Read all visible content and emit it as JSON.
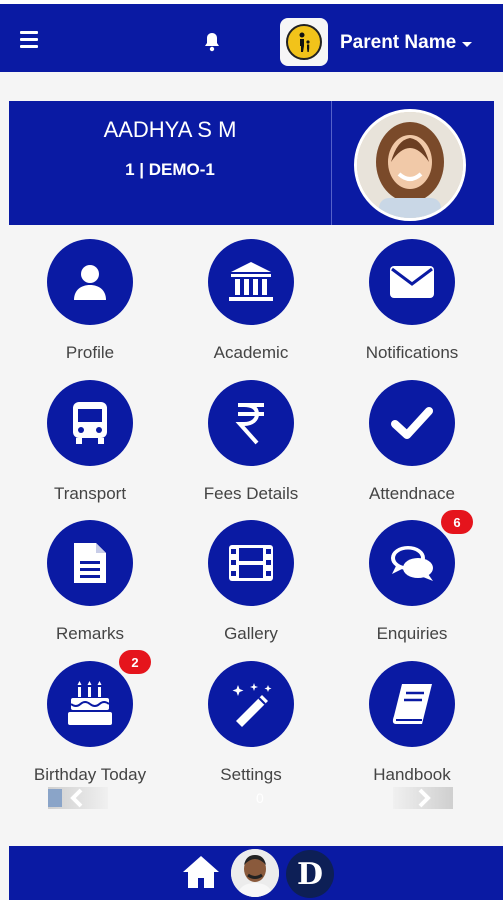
{
  "header": {
    "menu_icon": "hamburger-icon",
    "notification_icon": "bell-icon",
    "parent_logo": "parent-child-logo",
    "parent_name": "Parent Name"
  },
  "student": {
    "name": "AADHYA S M",
    "class_section": "1 | DEMO-1"
  },
  "menu": [
    {
      "label": "Profile",
      "icon": "user-icon"
    },
    {
      "label": "Academic",
      "icon": "bank-icon"
    },
    {
      "label": "Notifications",
      "icon": "envelope-icon"
    },
    {
      "label": "Transport",
      "icon": "bus-icon"
    },
    {
      "label": "Fees Details",
      "icon": "rupee-icon"
    },
    {
      "label": "Attendnace",
      "icon": "check-icon"
    },
    {
      "label": "Remarks",
      "icon": "document-icon"
    },
    {
      "label": "Gallery",
      "icon": "film-icon"
    },
    {
      "label": "Enquiries",
      "icon": "chat-icon",
      "badge": "6"
    },
    {
      "label": "Birthday Today",
      "icon": "birthday-cake-icon",
      "badge": "2"
    },
    {
      "label": "Settings",
      "icon": "magic-wand-icon"
    },
    {
      "label": "Handbook",
      "icon": "book-icon"
    }
  ],
  "carousel": {
    "indicator": "0"
  },
  "footer": {
    "home_icon": "home-icon",
    "avatar": "user-avatar",
    "logo_letter": "D"
  },
  "colors": {
    "primary": "#0a1aa3",
    "badge": "#e5141c",
    "background": "#f5f5f5"
  }
}
